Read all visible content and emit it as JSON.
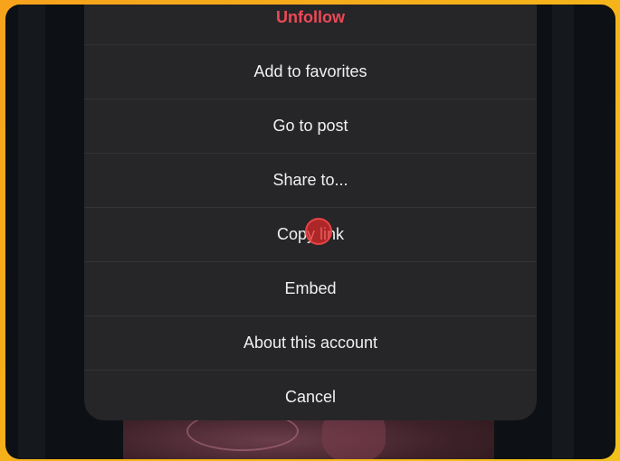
{
  "menu": {
    "items": [
      {
        "label": "Unfollow",
        "style": "danger"
      },
      {
        "label": "Add to favorites"
      },
      {
        "label": "Go to post"
      },
      {
        "label": "Share to..."
      },
      {
        "label": "Copy link"
      },
      {
        "label": "Embed"
      },
      {
        "label": "About this account"
      },
      {
        "label": "Cancel"
      }
    ]
  },
  "colors": {
    "danger": "#ed4956",
    "modal_bg": "#262629",
    "outer_frame": "#f5b21a",
    "cursor": "#dc2828"
  }
}
